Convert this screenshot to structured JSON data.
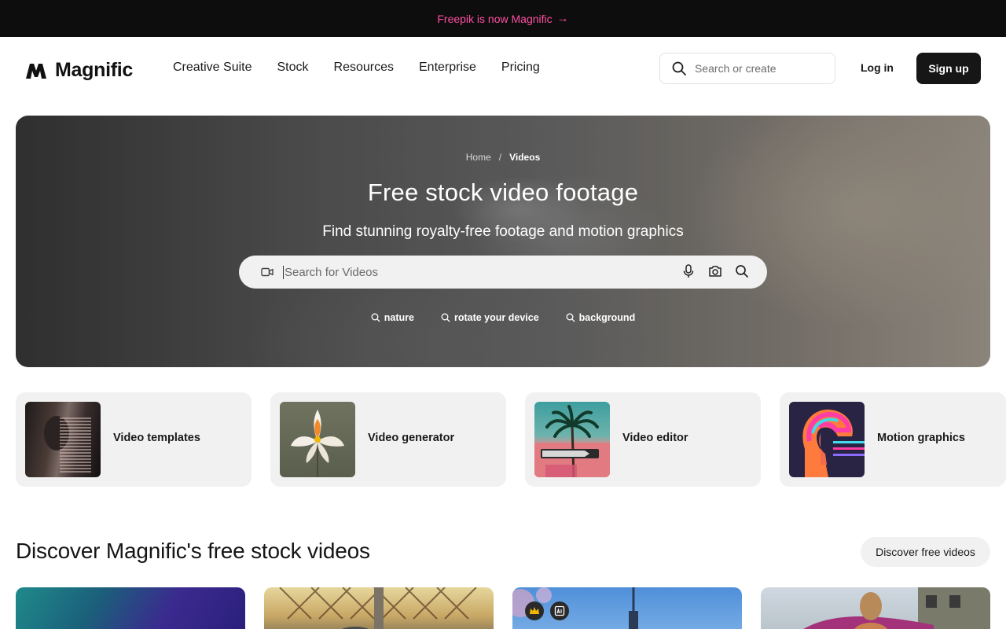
{
  "announcement": {
    "text": "Freepik is now Magnific",
    "arrow": "→"
  },
  "header": {
    "logo_text": "Magnific",
    "nav": [
      "Creative Suite",
      "Stock",
      "Resources",
      "Enterprise",
      "Pricing"
    ],
    "search_placeholder": "Search or create",
    "login_label": "Log in",
    "signup_label": "Sign up"
  },
  "hero": {
    "breadcrumb": {
      "home": "Home",
      "separator": "/",
      "current": "Videos"
    },
    "title": "Free stock video footage",
    "subtitle": "Find stunning royalty-free footage and motion graphics",
    "search_placeholder": "Search for Videos",
    "tags": [
      "nature",
      "rotate your device",
      "background"
    ]
  },
  "categories": [
    {
      "label": "Video templates"
    },
    {
      "label": "Video generator"
    },
    {
      "label": "Video editor"
    },
    {
      "label": "Motion graphics"
    }
  ],
  "discover": {
    "title": "Discover Magnific's free stock videos",
    "button_label": "Discover free videos"
  },
  "colors": {
    "announcement_bg": "#0d0d0d",
    "announcement_text": "#ff4fa3",
    "signup_bg": "#161616",
    "card_bg": "#f1f1f1",
    "premium_badge": "#f2b705"
  },
  "icons": {
    "header_search": "search-icon",
    "hero_video": "video-camera-icon",
    "hero_mic": "microphone-icon",
    "hero_camera": "camera-icon",
    "hero_search": "search-icon",
    "tag": "search-icon",
    "badge_premium": "crown-icon",
    "badge_ai": "ai-generated-icon"
  }
}
